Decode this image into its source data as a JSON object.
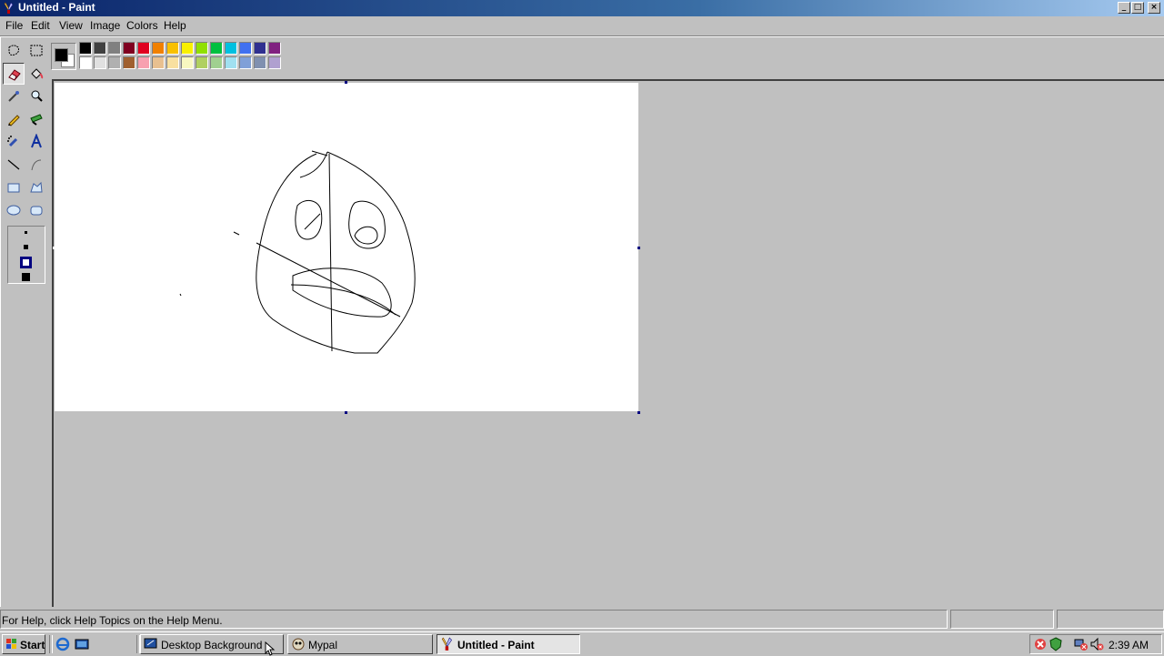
{
  "window": {
    "title": "Untitled - Paint"
  },
  "caption_buttons": {
    "minimize": "_",
    "maximize": "□",
    "close": "×"
  },
  "menu": [
    "File",
    "Edit",
    "View",
    "Image",
    "Colors",
    "Help"
  ],
  "tools": [
    {
      "name": "free-form-select-icon"
    },
    {
      "name": "select-icon"
    },
    {
      "name": "eraser-icon",
      "selected": true
    },
    {
      "name": "fill-bucket-icon"
    },
    {
      "name": "pick-color-icon"
    },
    {
      "name": "magnifier-icon"
    },
    {
      "name": "pencil-icon"
    },
    {
      "name": "brush-icon"
    },
    {
      "name": "airbrush-icon"
    },
    {
      "name": "text-icon",
      "glyph": "A"
    },
    {
      "name": "line-icon"
    },
    {
      "name": "curve-icon"
    },
    {
      "name": "rectangle-icon"
    },
    {
      "name": "polygon-icon"
    },
    {
      "name": "ellipse-icon"
    },
    {
      "name": "rounded-rectangle-icon"
    }
  ],
  "colors": {
    "foreground": "#000000",
    "background": "#ffffff",
    "palette_top": [
      "#000000",
      "#404040",
      "#808080",
      "#800020",
      "#e00020",
      "#f08000",
      "#f8c000",
      "#f8f000",
      "#90e000",
      "#00c040",
      "#00c0e0",
      "#4070f0",
      "#303090",
      "#802080"
    ],
    "palette_bottom": [
      "#ffffff",
      "#e0e0e0",
      "#b0b0b0",
      "#a06030",
      "#f8a0b0",
      "#e8c090",
      "#f8e0a0",
      "#f8f8c0",
      "#b0d060",
      "#a0d090",
      "#a0e0f0",
      "#80a0d8",
      "#8090b0",
      "#b0a0d0"
    ]
  },
  "status": {
    "help_text": "For Help, click Help Topics on the Help Menu."
  },
  "taskbar": {
    "start_label": "Start",
    "tasks": [
      {
        "label": "Desktop Background",
        "active": false
      },
      {
        "label": "Mypal",
        "active": false
      },
      {
        "label": "Untitled - Paint",
        "active": true
      }
    ],
    "clock": "2:39 AM"
  }
}
